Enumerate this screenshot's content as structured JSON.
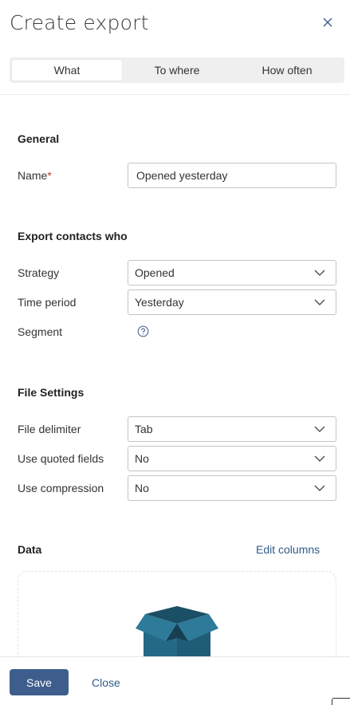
{
  "dialog": {
    "title": "Create export"
  },
  "tabs": [
    {
      "label": "What",
      "active": true
    },
    {
      "label": "To where",
      "active": false
    },
    {
      "label": "How often",
      "active": false
    }
  ],
  "general": {
    "heading": "General",
    "name_label": "Name",
    "required_marker": "*",
    "name_value": "Opened yesterday"
  },
  "contacts": {
    "heading": "Export contacts who",
    "strategy_label": "Strategy",
    "strategy_value": "Opened",
    "time_period_label": "Time period",
    "time_period_value": "Yesterday",
    "segment_label": "Segment"
  },
  "file_settings": {
    "heading": "File Settings",
    "delimiter_label": "File delimiter",
    "delimiter_value": "Tab",
    "quoted_label": "Use quoted fields",
    "quoted_value": "No",
    "compression_label": "Use compression",
    "compression_value": "No"
  },
  "data": {
    "heading": "Data",
    "edit_columns_label": "Edit columns"
  },
  "footer": {
    "save_label": "Save",
    "close_label": "Close"
  },
  "colors": {
    "accent": "#3d5e8c",
    "link": "#2f5d8c",
    "required": "#c0392b",
    "box_teal": "#2a6f8a"
  }
}
